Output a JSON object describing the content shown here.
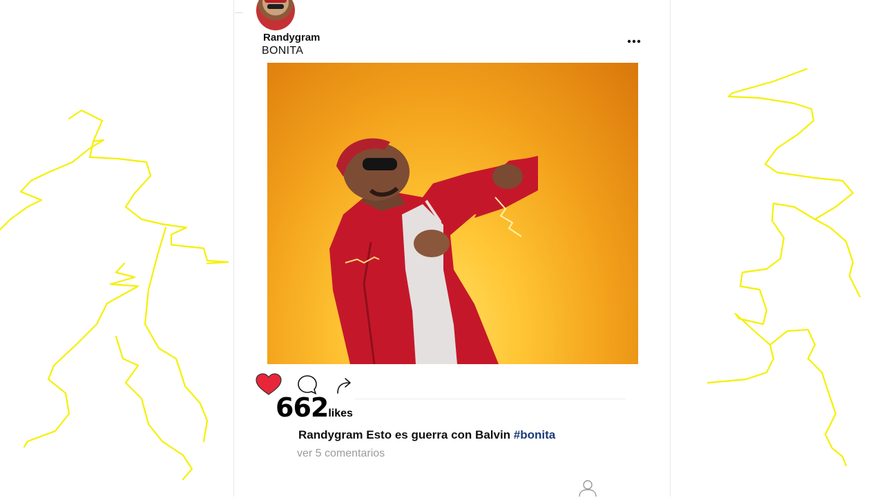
{
  "post": {
    "username": "Randygram",
    "subtitle": "BONITA",
    "likes_count": "662",
    "likes_label": "likes",
    "caption_user": "Randygram",
    "caption_text": "Esto es guerra con Balvin",
    "caption_hashtag": "#bonita",
    "view_comments": "ver 5 comentarios",
    "liked": true
  },
  "icons": {
    "more": "more-horizontal-icon",
    "like": "heart-icon",
    "comment": "comment-bubble-icon",
    "share": "share-arrow-icon",
    "profile": "profile-icon"
  },
  "colors": {
    "heart": "#e8263a",
    "hashtag": "#1d3a7a",
    "scribble": "#f5f000",
    "photo_background": "#f3a21c"
  }
}
